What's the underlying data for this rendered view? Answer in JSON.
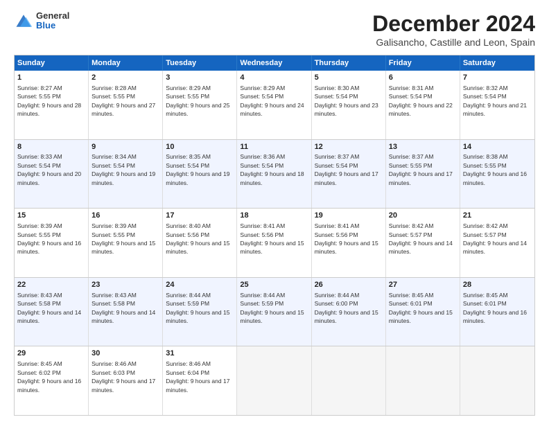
{
  "logo": {
    "general": "General",
    "blue": "Blue"
  },
  "title": "December 2024",
  "subtitle": "Galisancho, Castille and Leon, Spain",
  "header_days": [
    "Sunday",
    "Monday",
    "Tuesday",
    "Wednesday",
    "Thursday",
    "Friday",
    "Saturday"
  ],
  "rows": [
    [
      {
        "day": "1",
        "sunrise": "Sunrise: 8:27 AM",
        "sunset": "Sunset: 5:55 PM",
        "daylight": "Daylight: 9 hours and 28 minutes."
      },
      {
        "day": "2",
        "sunrise": "Sunrise: 8:28 AM",
        "sunset": "Sunset: 5:55 PM",
        "daylight": "Daylight: 9 hours and 27 minutes."
      },
      {
        "day": "3",
        "sunrise": "Sunrise: 8:29 AM",
        "sunset": "Sunset: 5:55 PM",
        "daylight": "Daylight: 9 hours and 25 minutes."
      },
      {
        "day": "4",
        "sunrise": "Sunrise: 8:29 AM",
        "sunset": "Sunset: 5:54 PM",
        "daylight": "Daylight: 9 hours and 24 minutes."
      },
      {
        "day": "5",
        "sunrise": "Sunrise: 8:30 AM",
        "sunset": "Sunset: 5:54 PM",
        "daylight": "Daylight: 9 hours and 23 minutes."
      },
      {
        "day": "6",
        "sunrise": "Sunrise: 8:31 AM",
        "sunset": "Sunset: 5:54 PM",
        "daylight": "Daylight: 9 hours and 22 minutes."
      },
      {
        "day": "7",
        "sunrise": "Sunrise: 8:32 AM",
        "sunset": "Sunset: 5:54 PM",
        "daylight": "Daylight: 9 hours and 21 minutes."
      }
    ],
    [
      {
        "day": "8",
        "sunrise": "Sunrise: 8:33 AM",
        "sunset": "Sunset: 5:54 PM",
        "daylight": "Daylight: 9 hours and 20 minutes."
      },
      {
        "day": "9",
        "sunrise": "Sunrise: 8:34 AM",
        "sunset": "Sunset: 5:54 PM",
        "daylight": "Daylight: 9 hours and 19 minutes."
      },
      {
        "day": "10",
        "sunrise": "Sunrise: 8:35 AM",
        "sunset": "Sunset: 5:54 PM",
        "daylight": "Daylight: 9 hours and 19 minutes."
      },
      {
        "day": "11",
        "sunrise": "Sunrise: 8:36 AM",
        "sunset": "Sunset: 5:54 PM",
        "daylight": "Daylight: 9 hours and 18 minutes."
      },
      {
        "day": "12",
        "sunrise": "Sunrise: 8:37 AM",
        "sunset": "Sunset: 5:54 PM",
        "daylight": "Daylight: 9 hours and 17 minutes."
      },
      {
        "day": "13",
        "sunrise": "Sunrise: 8:37 AM",
        "sunset": "Sunset: 5:55 PM",
        "daylight": "Daylight: 9 hours and 17 minutes."
      },
      {
        "day": "14",
        "sunrise": "Sunrise: 8:38 AM",
        "sunset": "Sunset: 5:55 PM",
        "daylight": "Daylight: 9 hours and 16 minutes."
      }
    ],
    [
      {
        "day": "15",
        "sunrise": "Sunrise: 8:39 AM",
        "sunset": "Sunset: 5:55 PM",
        "daylight": "Daylight: 9 hours and 16 minutes."
      },
      {
        "day": "16",
        "sunrise": "Sunrise: 8:39 AM",
        "sunset": "Sunset: 5:55 PM",
        "daylight": "Daylight: 9 hours and 15 minutes."
      },
      {
        "day": "17",
        "sunrise": "Sunrise: 8:40 AM",
        "sunset": "Sunset: 5:56 PM",
        "daylight": "Daylight: 9 hours and 15 minutes."
      },
      {
        "day": "18",
        "sunrise": "Sunrise: 8:41 AM",
        "sunset": "Sunset: 5:56 PM",
        "daylight": "Daylight: 9 hours and 15 minutes."
      },
      {
        "day": "19",
        "sunrise": "Sunrise: 8:41 AM",
        "sunset": "Sunset: 5:56 PM",
        "daylight": "Daylight: 9 hours and 15 minutes."
      },
      {
        "day": "20",
        "sunrise": "Sunrise: 8:42 AM",
        "sunset": "Sunset: 5:57 PM",
        "daylight": "Daylight: 9 hours and 14 minutes."
      },
      {
        "day": "21",
        "sunrise": "Sunrise: 8:42 AM",
        "sunset": "Sunset: 5:57 PM",
        "daylight": "Daylight: 9 hours and 14 minutes."
      }
    ],
    [
      {
        "day": "22",
        "sunrise": "Sunrise: 8:43 AM",
        "sunset": "Sunset: 5:58 PM",
        "daylight": "Daylight: 9 hours and 14 minutes."
      },
      {
        "day": "23",
        "sunrise": "Sunrise: 8:43 AM",
        "sunset": "Sunset: 5:58 PM",
        "daylight": "Daylight: 9 hours and 14 minutes."
      },
      {
        "day": "24",
        "sunrise": "Sunrise: 8:44 AM",
        "sunset": "Sunset: 5:59 PM",
        "daylight": "Daylight: 9 hours and 15 minutes."
      },
      {
        "day": "25",
        "sunrise": "Sunrise: 8:44 AM",
        "sunset": "Sunset: 5:59 PM",
        "daylight": "Daylight: 9 hours and 15 minutes."
      },
      {
        "day": "26",
        "sunrise": "Sunrise: 8:44 AM",
        "sunset": "Sunset: 6:00 PM",
        "daylight": "Daylight: 9 hours and 15 minutes."
      },
      {
        "day": "27",
        "sunrise": "Sunrise: 8:45 AM",
        "sunset": "Sunset: 6:01 PM",
        "daylight": "Daylight: 9 hours and 15 minutes."
      },
      {
        "day": "28",
        "sunrise": "Sunrise: 8:45 AM",
        "sunset": "Sunset: 6:01 PM",
        "daylight": "Daylight: 9 hours and 16 minutes."
      }
    ],
    [
      {
        "day": "29",
        "sunrise": "Sunrise: 8:45 AM",
        "sunset": "Sunset: 6:02 PM",
        "daylight": "Daylight: 9 hours and 16 minutes."
      },
      {
        "day": "30",
        "sunrise": "Sunrise: 8:46 AM",
        "sunset": "Sunset: 6:03 PM",
        "daylight": "Daylight: 9 hours and 17 minutes."
      },
      {
        "day": "31",
        "sunrise": "Sunrise: 8:46 AM",
        "sunset": "Sunset: 6:04 PM",
        "daylight": "Daylight: 9 hours and 17 minutes."
      },
      null,
      null,
      null,
      null
    ]
  ]
}
